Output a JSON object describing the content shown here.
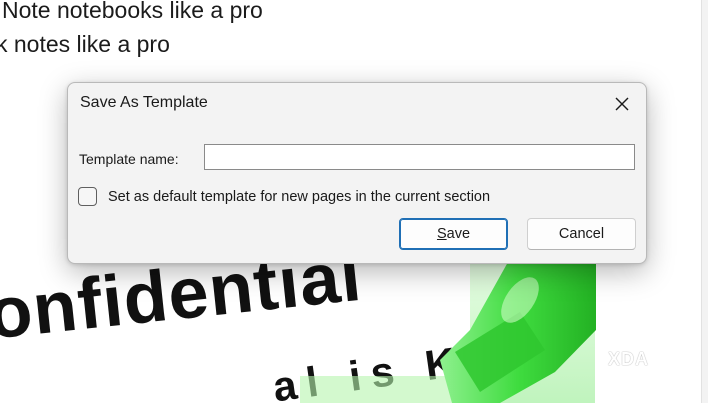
{
  "document": {
    "line1": "Note notebooks like a pro",
    "line2": "k notes like a pro"
  },
  "artwork": {
    "word": "onfidential",
    "word2": "al is  K",
    "watermark": "XDA",
    "marker_color": "#3fdc3f"
  },
  "dialog": {
    "title": "Save As Template",
    "close_icon": "close-icon",
    "template_name_label": "Template name:",
    "template_name_value": "",
    "default_checkbox_label": "Set as default template for new pages in the current section",
    "default_checked": false,
    "save_button": {
      "mnemonic": "S",
      "rest": "ave"
    },
    "cancel_button": "Cancel",
    "accent_color": "#1f6fb5"
  }
}
